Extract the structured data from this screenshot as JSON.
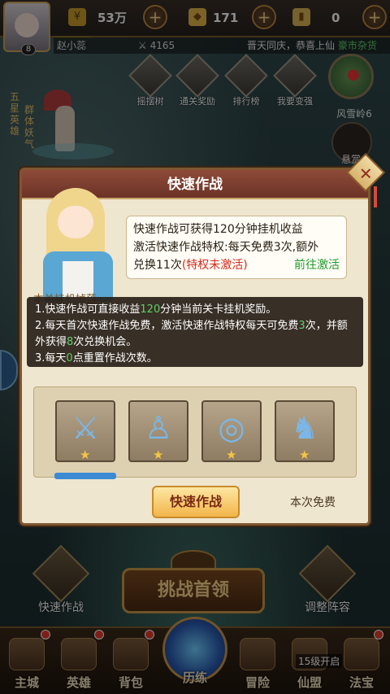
{
  "topbar": {
    "player_name": "赵小蕊",
    "player_level": "8",
    "power": "4165",
    "coins": "53万",
    "ingots": "171",
    "tokens": "0",
    "news_text": "晋天同庆，恭喜上仙",
    "news_link": "豪市杂货"
  },
  "top_icons": [
    {
      "label": "摇摆树"
    },
    {
      "label": "通关奖励"
    },
    {
      "label": "排行榜"
    },
    {
      "label": "我要变强"
    }
  ],
  "map": {
    "location": "风雪岭6",
    "hanging_label": "悬赏"
  },
  "hero_side": {
    "rank_text": "五星英雄",
    "title_text": "群体妖气"
  },
  "dialog": {
    "title": "快速作战",
    "bubble_line1": "快速作战可获得120分钟挂机收益",
    "bubble_line2": "激活快速作战特权:每天免费3次,额外",
    "bubble_line3_prefix": "兑换11次",
    "bubble_line3_red": "(特权未激活)",
    "bubble_link": "前往激活",
    "hidden_title": "本关挂机掉落",
    "tips": {
      "l1_a": "1.快速作战可直接收益",
      "l1_g": "120",
      "l1_b": "分钟当前关卡挂机奖励。",
      "l2_a": "2.每天首次快速作战免费，激活快速作战特权每天可免费",
      "l2_g1": "3",
      "l2_b": "次，并额外获得",
      "l2_g2": "8",
      "l2_c": "次兑换机会。",
      "l3_a": "3.每天",
      "l3_g": "0",
      "l3_b": "点重置作战次数。"
    },
    "rewards": [
      {
        "name": "dao",
        "icon": "sword-icon"
      },
      {
        "name": "robe",
        "icon": "robe-icon"
      },
      {
        "name": "belt",
        "icon": "belt-icon"
      },
      {
        "name": "boots",
        "icon": "boots-icon"
      }
    ],
    "action_button": "快速作战",
    "free_label": "本次免费"
  },
  "bottom_actions": {
    "quick_battle": "快速作战",
    "challenge_boss": "挑战首领",
    "adjust_formation": "调整阵容"
  },
  "navbar": {
    "items": [
      "主城",
      "英雄",
      "背包",
      "历练",
      "冒险",
      "仙盟",
      "法宝"
    ],
    "lock_text": "15级开启"
  },
  "colors": {
    "accent_red": "#d62a1c",
    "accent_green": "#1e9b2a",
    "gold": "#f2b54a"
  }
}
